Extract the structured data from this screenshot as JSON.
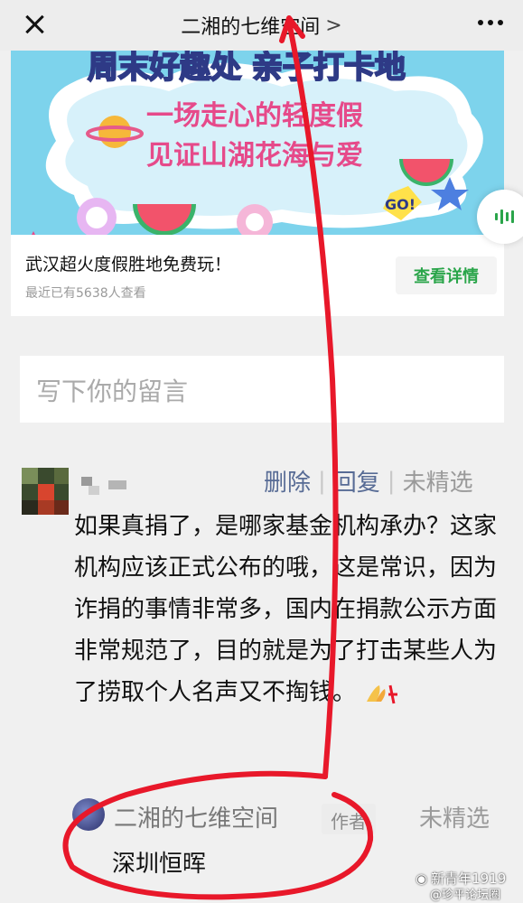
{
  "header": {
    "title": "二湘的七维空间",
    "chevron": ">",
    "close_icon": "close-icon",
    "more_icon": "more-dots-icon"
  },
  "ad": {
    "banner_line1": "周末好趣处 亲子打卡地",
    "banner_line2": "一场走心的轻度假",
    "banner_line3": "见证山湖花海与爱",
    "banner_go": "GO!",
    "caption": "武汉超火度假胜地免费玩！",
    "views": "最近已有5638人查看",
    "detail_button": "查看详情",
    "accent": "#2aa54a"
  },
  "comment_input": {
    "placeholder": "写下你的留言"
  },
  "comment": {
    "actions": {
      "delete": "删除",
      "separator": "|",
      "reply": "回复",
      "status": "未精选"
    },
    "text": "如果真捐了，是哪家基金机构承办？这家机构应该正式公布的哦，这是常识，因为诈捐的事情非常多，国内在捐款公示方面非常规范了，目的就是为了打击某些人为了捞取个人名声又不掏钱。"
  },
  "reply": {
    "author": "二湘的七维空间",
    "tag": "作者",
    "status": "未精选",
    "text": "深圳恒晖"
  },
  "watermark": {
    "line1": "新青年1919",
    "line2": "@珍平论坛圈"
  },
  "colors": {
    "link": "#576b95",
    "annotation_red": "#e8182a"
  }
}
